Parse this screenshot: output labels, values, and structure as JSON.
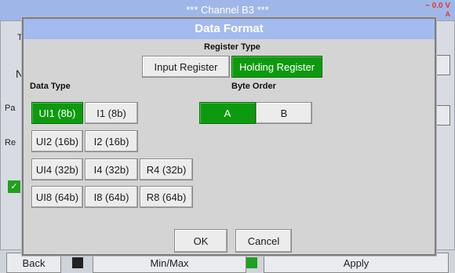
{
  "background": {
    "title": "*** Channel B3 ***",
    "corner_value": "~ 0.0 V",
    "corner_sub": "A",
    "left_fragments": [
      "T",
      "N",
      "Pa",
      "Re"
    ],
    "bottom_buttons": [
      "Back",
      "Min/Max",
      "Apply"
    ]
  },
  "dialog": {
    "title": "Data Format",
    "register_type": {
      "label": "Register Type",
      "options": [
        "Input Register",
        "Holding Register"
      ],
      "selected": "Holding Register"
    },
    "data_type": {
      "label": "Data Type",
      "rows": [
        [
          "UI1 (8b)",
          "I1 (8b)"
        ],
        [
          "UI2 (16b)",
          "I2 (16b)"
        ],
        [
          "UI4 (32b)",
          "I4 (32b)",
          "R4 (32b)"
        ],
        [
          "UI8 (64b)",
          "I8 (64b)",
          "R8 (64b)"
        ]
      ],
      "selected": "UI1 (8b)"
    },
    "byte_order": {
      "label": "Byte Order",
      "options": [
        "A",
        "B"
      ],
      "selected": "A"
    },
    "ok_label": "OK",
    "cancel_label": "Cancel"
  },
  "colors": {
    "header_bg": "#a4bbef",
    "selected_green": "#0e9a0e",
    "dialog_bg": "#d4d4d4"
  }
}
